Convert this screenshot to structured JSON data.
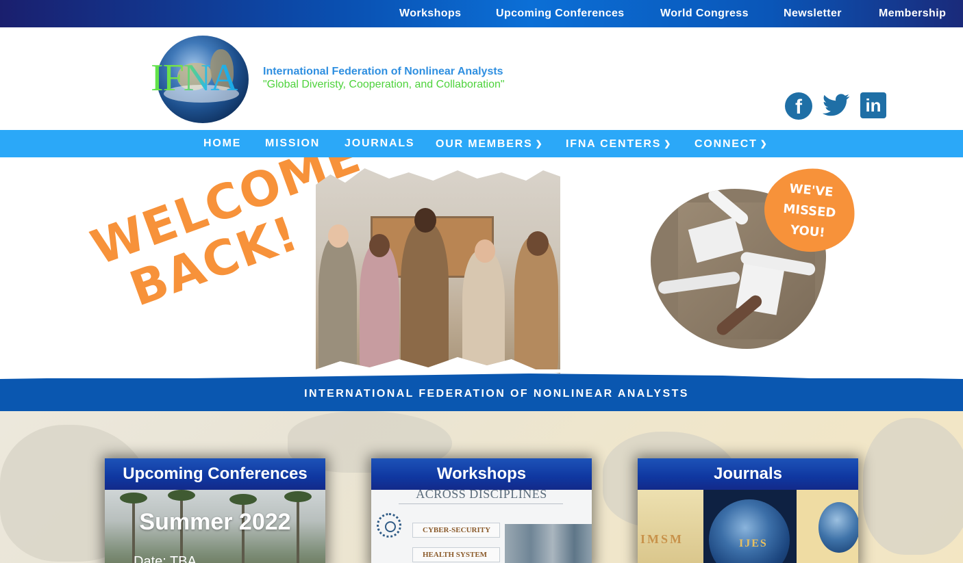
{
  "topnav": {
    "items": [
      "Workshops",
      "Upcoming Conferences",
      "World Congress",
      "Newsletter",
      "Membership"
    ]
  },
  "header": {
    "logo_text": "IFNA",
    "org_name": "International Federation of Nonlinear Analysts",
    "tagline": "\"Global Diveristy, Cooperation, and Collaboration\"",
    "social": [
      "facebook-icon",
      "twitter-icon",
      "linkedin-icon"
    ]
  },
  "mainnav": {
    "items": [
      {
        "label": "HOME",
        "dropdown": false
      },
      {
        "label": "MISSION",
        "dropdown": false
      },
      {
        "label": "JOURNALS",
        "dropdown": false
      },
      {
        "label": "OUR MEMBERS",
        "dropdown": true
      },
      {
        "label": "IFNA CENTERS",
        "dropdown": true
      },
      {
        "label": "CONNECT",
        "dropdown": true
      }
    ]
  },
  "hero": {
    "welcome_line1": "WELCOME",
    "welcome_line2": "BACK!",
    "missed_line1": "WE'VE",
    "missed_line2": "MISSED",
    "missed_line3": "YOU!",
    "band_text": "INTERNATIONAL FEDERATION OF NONLINEAR ANALYSTS"
  },
  "cards": {
    "conferences": {
      "title": "Upcoming Conferences",
      "headline": "Summer 2022",
      "date": "Date: TBA"
    },
    "workshops": {
      "title": "Workshops",
      "subtitle": "ACROSS DISCIPLINES",
      "pills": [
        "CYBER-SECURITY",
        "HEALTH SYSTEM"
      ]
    },
    "journals": {
      "title": "Journals",
      "labels": [
        "IMSM",
        "IJES"
      ]
    }
  },
  "colors": {
    "nav_blue": "#2ba8f8",
    "band_blue": "#0a57b0",
    "accent_orange": "#f7923a",
    "org_blue": "#2f8fe0",
    "tagline_green": "#4dd23b"
  }
}
